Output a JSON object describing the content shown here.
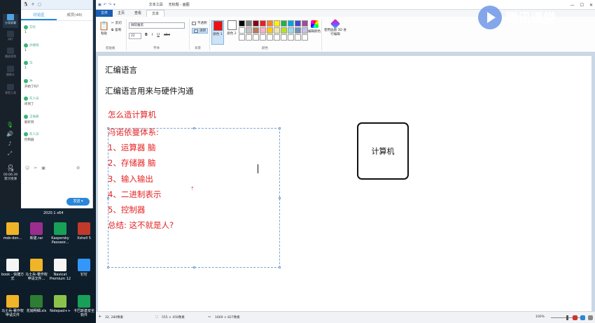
{
  "chat": {
    "top_icons": [
      "🐧",
      "✈",
      "▢"
    ],
    "tabs": [
      {
        "label": "讨论区"
      },
      {
        "label": "成员(48)"
      }
    ],
    "messages": [
      {
        "user": "艾纶",
        "text": "1"
      },
      {
        "user": "孙德阳",
        "text": "1"
      },
      {
        "user": "马",
        "text": "1"
      },
      {
        "user": "冲",
        "text": "开始了吗?"
      },
      {
        "user": "灰人员",
        "text": "听到了"
      },
      {
        "user": "王振楠",
        "text": "能听到"
      },
      {
        "user": "灰人员",
        "text": "控制器"
      }
    ],
    "send_label": "发送 ▾"
  },
  "sidebar": {
    "items": [
      "分享屏幕",
      "PPT",
      "播放视频",
      "摄像头",
      "课堂工具"
    ],
    "timer": "00:06:39",
    "timer_sub": "累计授课",
    "download_label": "下课"
  },
  "desktop": {
    "top_label": "2020.1 x64",
    "icons": [
      {
        "label": "msb-don...",
        "color": "#f0b429"
      },
      {
        "label": "新建.rar",
        "color": "#9b2d8f"
      },
      {
        "label": "Kaspersky Passwor...",
        "color": "#18a058"
      },
      {
        "label": "Xshell 5",
        "color": "#c0392b"
      },
      {
        "label": "book - 快捷方式",
        "color": "#f5f5f5"
      },
      {
        "label": "马士兵-著作权申请文件...",
        "color": "#f0b429"
      },
      {
        "label": "Navicat Premium 12",
        "color": "#f5f5f5"
      },
      {
        "label": "钉钉",
        "color": "#3296fa"
      },
      {
        "label": "马士兵-著作权申请文件",
        "color": "#f0b429"
      },
      {
        "label": "花销明细.xls",
        "color": "#2e7d32"
      },
      {
        "label": "Notepad++",
        "color": "#8bc34a"
      },
      {
        "label": "卡巴斯基安全软件",
        "color": "#18a058"
      }
    ]
  },
  "paint": {
    "context_tab": "文本工具",
    "title": "无标题 - 画图",
    "tabs": [
      "文件",
      "主页",
      "查看",
      "文本"
    ],
    "clipboard": {
      "paste": "粘贴",
      "cut": "剪切",
      "copy": "复制",
      "group": "剪贴板"
    },
    "font": {
      "name": "微软雅黑",
      "size": "22",
      "bold": "B",
      "italic": "I",
      "underline": "U",
      "strike": "abc",
      "group": "字体"
    },
    "background": {
      "opaque": "不透明",
      "transparent": "透明",
      "group": "背景"
    },
    "color1_label": "颜色 1",
    "color2_label": "颜色 2",
    "color1": "#ee1111",
    "color2": "#ffffff",
    "colors_group": "颜色",
    "edit_colors": "编辑颜色",
    "paint3d": "使用画图 3D 进行编辑",
    "palette": [
      "#000000",
      "#7f7f7f",
      "#880015",
      "#ed1c24",
      "#ff7f27",
      "#fff200",
      "#22b14c",
      "#00a2e8",
      "#3f48cc",
      "#a349a4",
      "#ffffff",
      "#c3c3c3",
      "#b97a57",
      "#ffaec9",
      "#ffc90e",
      "#efe4b0",
      "#b5e61d",
      "#99d9ea",
      "#7092be",
      "#c8bfe7",
      "#ffffff",
      "#ffffff",
      "#ffffff",
      "#ffffff",
      "#ffffff",
      "#ffffff",
      "#ffffff",
      "#ffffff",
      "#ffffff",
      "#ffffff"
    ],
    "window_buttons": [
      "—",
      "☐",
      "✕"
    ]
  },
  "canvas": {
    "heading1": "汇编语言",
    "heading2": "汇编语言用来与硬件沟通",
    "lines": [
      "怎么造计算机",
      "冯诺依曼体系:",
      "1、运算器 脑",
      "2、存储器 脑",
      "3、输入输出",
      "4、二进制表示",
      "5、控制器",
      "总结:   这不就是人?"
    ],
    "box_label": "计算机"
  },
  "status": {
    "cursor": "32, 280像素",
    "selection": "555 × 456像素",
    "size": "1669 × 827像素",
    "zoom": "100%"
  },
  "watermark": "腾讯课堂"
}
